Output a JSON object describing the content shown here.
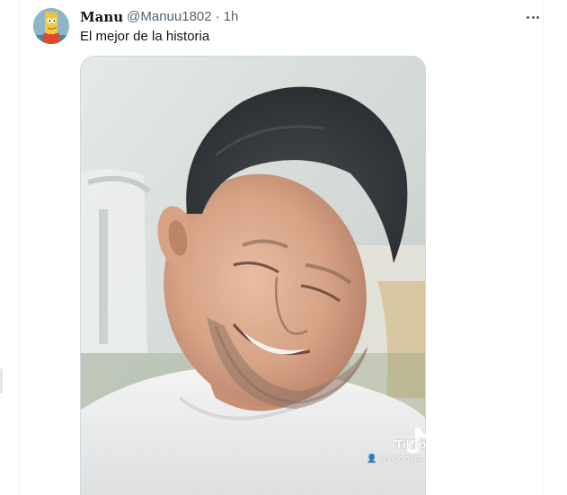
{
  "tweet": {
    "author": {
      "display_name": "Manu",
      "handle": "@Manuu1802",
      "avatar_icon": "cartoon-character-avatar"
    },
    "separator": "·",
    "time": "1h",
    "text": "El mejor de la historia",
    "more_icon": "more-horizontal-icon",
    "media": {
      "kind": "video-still",
      "watermark": "TikTo",
      "watermark_user": "@vickygenc"
    }
  },
  "colors": {
    "text_primary": "#0f1419",
    "text_secondary": "#536471",
    "border": "#cfd9de",
    "divider": "#eff3f4"
  }
}
